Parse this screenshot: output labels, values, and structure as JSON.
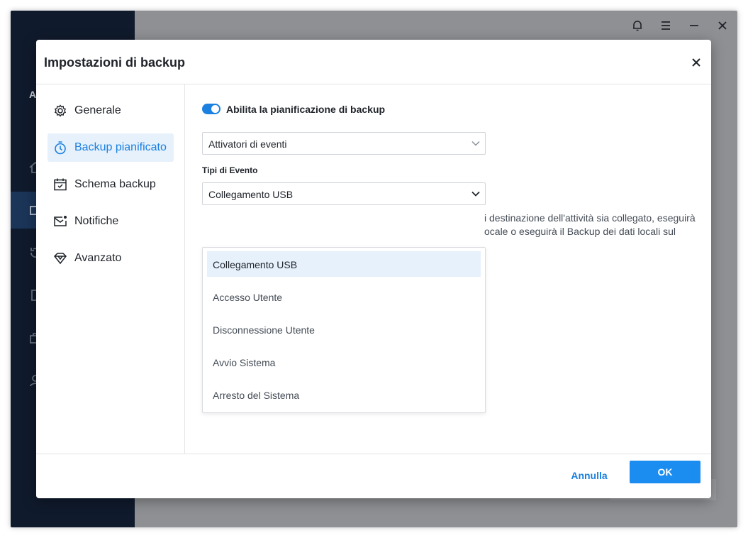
{
  "app": {
    "sidebar_letter": "A",
    "titlebar_icons": [
      "bell-icon",
      "menu-icon",
      "minimize-icon",
      "close-icon"
    ]
  },
  "dialog": {
    "title": "Impostazioni di backup",
    "close_icon": "close-icon",
    "nav": [
      {
        "label": "Generale",
        "icon": "gear-icon",
        "active": false
      },
      {
        "label": "Backup pianificato",
        "icon": "timer-icon",
        "active": true
      },
      {
        "label": "Schema backup",
        "icon": "calendar-check-icon",
        "active": false
      },
      {
        "label": "Notifiche",
        "icon": "mail-notification-icon",
        "active": false
      },
      {
        "label": "Avanzato",
        "icon": "diamond-icon",
        "active": false
      }
    ],
    "schedule": {
      "toggle_label": "Abilita la pianificazione di backup",
      "toggle_on": true,
      "trigger_select": "Attivatori di eventi",
      "event_type_label": "Tipi di Evento",
      "event_type_select": "Collegamento USB",
      "description_lines": [
        "i destinazione dell'attività sia collegato, eseguirà",
        "ocale o eseguirà il Backup dei dati locali sul"
      ],
      "dropdown_options": [
        "Collegamento USB",
        "Accesso Utente",
        "Disconnessione Utente",
        "Avvio Sistema",
        "Arresto del Sistema"
      ],
      "selected_option": "Collegamento USB"
    },
    "footer": {
      "cancel_label": "Annulla",
      "ok_label": "OK"
    }
  },
  "colors": {
    "accent": "#1b80e0",
    "ok_button": "#1b8cf0",
    "app_sidebar": "#0f1a2c",
    "overlay": "#8e9094",
    "selected_bg": "#e6f1fc"
  }
}
